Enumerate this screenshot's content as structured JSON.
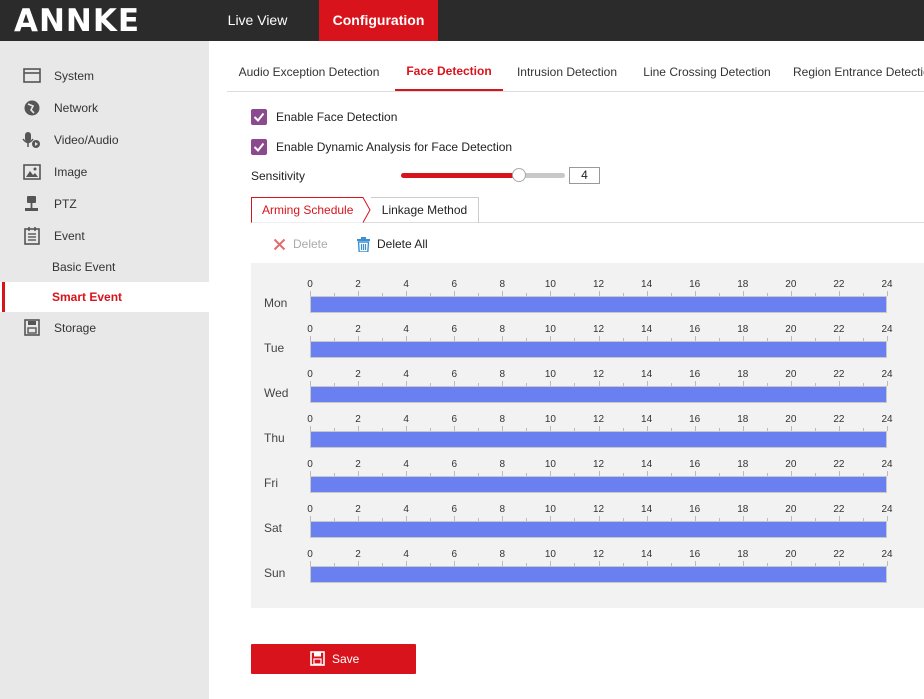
{
  "brand": {
    "logo": "ANNKE",
    "accent": "#d9131c",
    "checkbox_color": "#8b4a8e",
    "bar_color": "#6a7ff0"
  },
  "topnav": {
    "live_view": "Live View",
    "configuration": "Configuration"
  },
  "sidebar": {
    "items": [
      {
        "label": "System",
        "icon": "system-icon"
      },
      {
        "label": "Network",
        "icon": "network-icon"
      },
      {
        "label": "Video/Audio",
        "icon": "video-audio-icon"
      },
      {
        "label": "Image",
        "icon": "image-icon"
      },
      {
        "label": "PTZ",
        "icon": "ptz-icon"
      },
      {
        "label": "Event",
        "icon": "event-icon"
      }
    ],
    "sub_items": [
      "Basic Event",
      "Smart Event"
    ],
    "storage": "Storage",
    "active": "Smart Event"
  },
  "tabs": [
    "Audio Exception Detection",
    "Face Detection",
    "Intrusion Detection",
    "Line Crossing Detection",
    "Region Entrance Detection"
  ],
  "active_tab": "Face Detection",
  "options": {
    "enable_face_detection": "Enable Face Detection",
    "enable_dynamic_analysis": "Enable Dynamic Analysis for Face Detection"
  },
  "sensitivity": {
    "label": "Sensitivity",
    "value": "4",
    "level_fraction": 0.72
  },
  "subtabs": {
    "arming_schedule": "Arming Schedule",
    "linkage_method": "Linkage Method"
  },
  "actions": {
    "delete": "Delete",
    "delete_all": "Delete All"
  },
  "schedule": {
    "days": [
      "Mon",
      "Tue",
      "Wed",
      "Thu",
      "Fri",
      "Sat",
      "Sun"
    ],
    "hour_ticks": [
      "0",
      "2",
      "4",
      "6",
      "8",
      "10",
      "12",
      "14",
      "16",
      "18",
      "20",
      "22",
      "24"
    ],
    "armed_from_hour": 0,
    "armed_to_hour": 24
  },
  "save": "Save"
}
